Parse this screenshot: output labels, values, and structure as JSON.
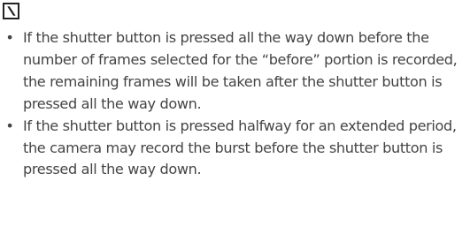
{
  "note": {
    "icon": "caution-note-icon",
    "items": [
      {
        "bullet": "•",
        "text": "If the shutter button is pressed all the way down before the number of frames selected for the “before” portion is recorded, the remaining frames will be taken after the shutter button is pressed all the way down."
      },
      {
        "bullet": "•",
        "text": "If the shutter button is pressed halfway for an extended period, the camera may record the burst before the shutter button is pressed all the way down."
      }
    ]
  }
}
